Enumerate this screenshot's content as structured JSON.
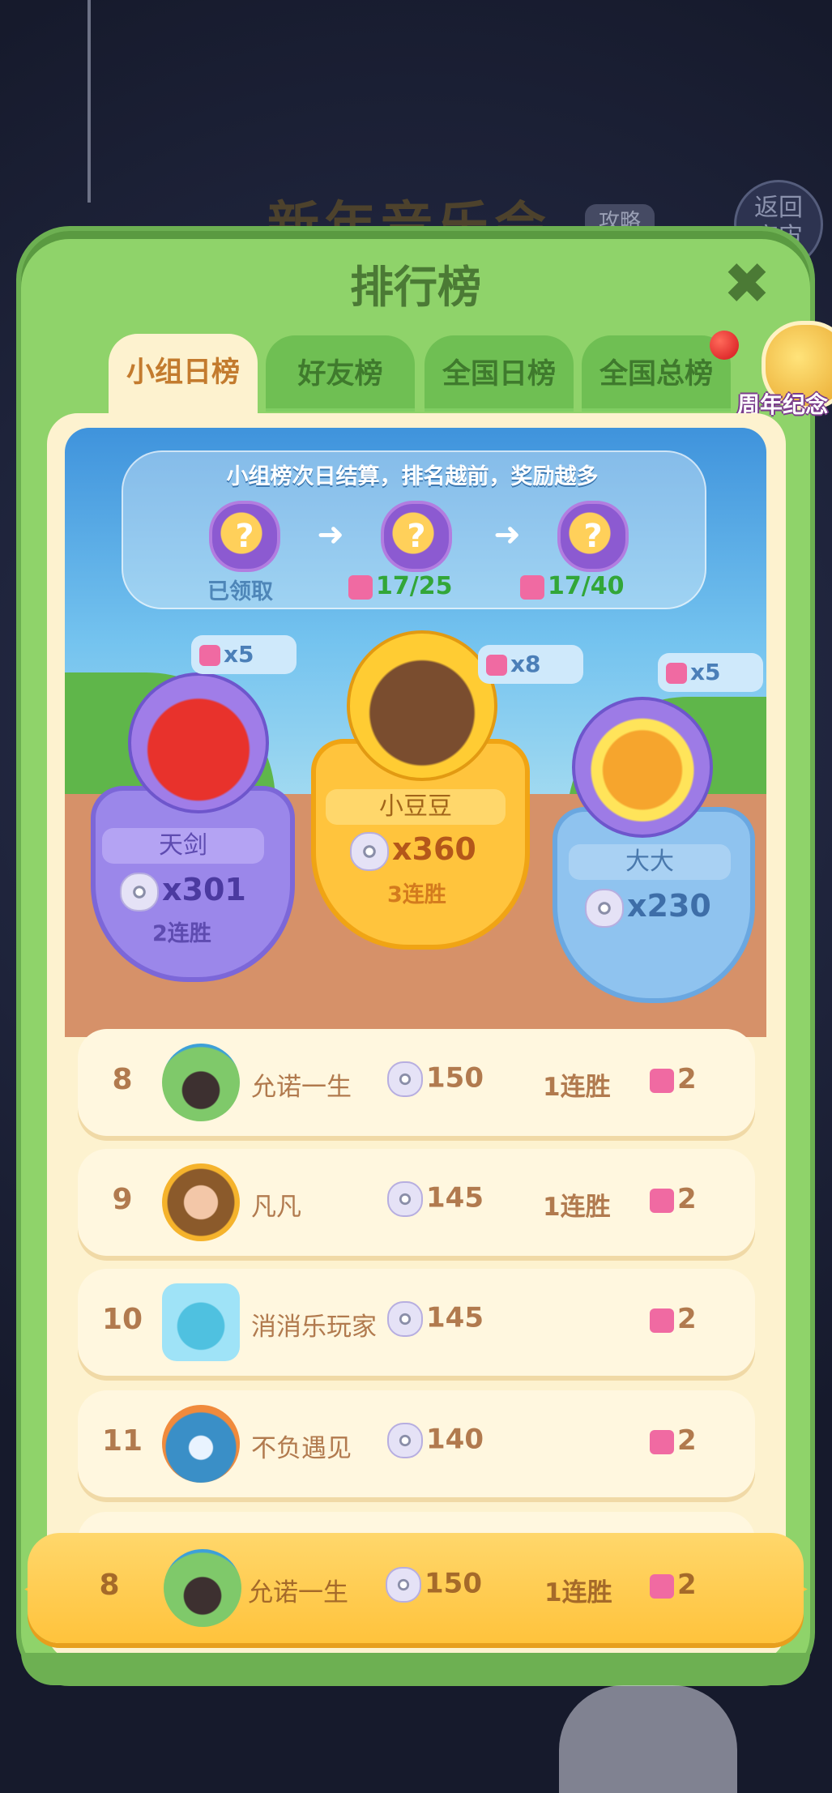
{
  "background": {
    "event_title": "新年音乐会",
    "guide_label": "攻略",
    "back_label": "返回\n宇宙"
  },
  "panel": {
    "title": "排行榜",
    "close_icon": "close-icon"
  },
  "tabs": [
    {
      "label": "小组日榜",
      "active": true
    },
    {
      "label": "好友榜",
      "active": false
    },
    {
      "label": "全国日榜",
      "active": false
    },
    {
      "label": "全国总榜",
      "active": false,
      "badge": true
    }
  ],
  "anniversary": {
    "label": "周年纪念"
  },
  "rewards": {
    "banner_text": "小组榜次日结算，排名越前，奖励越多",
    "chests": [
      {
        "status": "已领取"
      },
      {
        "progress": "17/25"
      },
      {
        "progress": "17/40"
      }
    ]
  },
  "podium": [
    {
      "position": "left",
      "name": "天剑",
      "score": "x301",
      "streak": "2连胜",
      "pieces": "x5"
    },
    {
      "position": "middle",
      "name": "小豆豆",
      "score": "x360",
      "streak": "3连胜",
      "pieces": "x8"
    },
    {
      "position": "right",
      "name": "大大",
      "score": "x230",
      "streak": "",
      "pieces": "x5"
    }
  ],
  "rankings": [
    {
      "rank": "8",
      "name": "允诺一生",
      "score": "150",
      "streak": "1连胜",
      "pieces": "2"
    },
    {
      "rank": "9",
      "name": "凡凡",
      "score": "145",
      "streak": "1连胜",
      "pieces": "2"
    },
    {
      "rank": "10",
      "name": "消消乐玩家",
      "score": "145",
      "streak": "",
      "pieces": "2"
    },
    {
      "rank": "11",
      "name": "不负遇见",
      "score": "140",
      "streak": "",
      "pieces": "2"
    }
  ],
  "self": {
    "rank": "8",
    "name": "允诺一生",
    "score": "150",
    "streak": "1连胜",
    "pieces": "2"
  },
  "colors": {
    "panel_green": "#8fd36a",
    "tab_active": "#fdf2cf",
    "gold": "#ffc43d",
    "purple": "#9b87ea",
    "blue": "#8fc3ef",
    "text_brown": "#b17a4e"
  }
}
